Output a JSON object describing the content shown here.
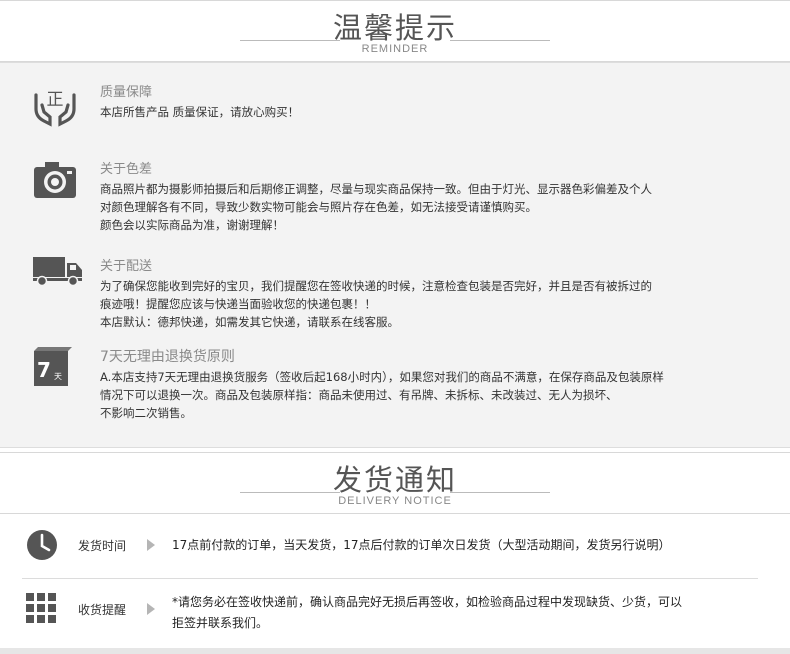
{
  "reminder": {
    "title": "温馨提示",
    "subtitle": "REMINDER",
    "items": [
      {
        "icon": "zheng-hands-icon",
        "icon_text": "正",
        "title": "质量保障",
        "lines": [
          "本店所售产品 质量保证，请放心购买！"
        ]
      },
      {
        "icon": "camera-icon",
        "title": "关于色差",
        "lines": [
          "商品照片都为摄影师拍摄后和后期修正调整，尽量与现实商品保持一致。但由于灯光、显示器色彩偏差及个人",
          "对颜色理解各有不同，导致少数实物可能会与照片存在色差，如无法接受请谨慎购买。",
          "颜色会以实际商品为准，谢谢理解！"
        ]
      },
      {
        "icon": "truck-icon",
        "title": "关于配送",
        "lines": [
          "为了确保您能收到完好的宝贝，我们提醒您在签收快递的时候，注意检查包装是否完好，并且是否有被拆过的",
          "痕迹哦！提醒您应该与快递当面验收您的快递包裹！！",
          "本店默认：德邦快递，如需发其它快递，请联系在线客服。"
        ]
      },
      {
        "icon": "seven-day-icon",
        "icon_text": "7",
        "icon_small": "天",
        "title": "7天无理由退换货原则",
        "lines": [
          "A.本店支持7天无理由退换货服务（签收后起168小时内），如果您对我们的商品不满意，在保存商品及包装原样",
          "情况下可以退换一次。商品及包装原样指：商品未使用过、有吊牌、未拆标、未改装过、无人为损坏、",
          "不影响二次销售。"
        ]
      }
    ]
  },
  "delivery": {
    "title": "发货通知",
    "subtitle": "DELIVERY NOTICE",
    "rows": [
      {
        "icon": "clock-icon",
        "label": "发货时间",
        "lines": [
          "17点前付款的订单，当天发货，17点后付款的订单次日发货（大型活动期间，发货另行说明）"
        ]
      },
      {
        "icon": "grid-icon",
        "label": "收货提醒",
        "lines": [
          "*请您务必在签收快递前，确认商品完好无损后再签收，如检验商品过程中发现缺货、少货，可以",
          "拒签并联系我们。"
        ]
      }
    ]
  },
  "colors": {
    "icon_gray": "#555555",
    "panel_bg": "#f3f3f3",
    "title_gray": "#8a8a8a"
  }
}
